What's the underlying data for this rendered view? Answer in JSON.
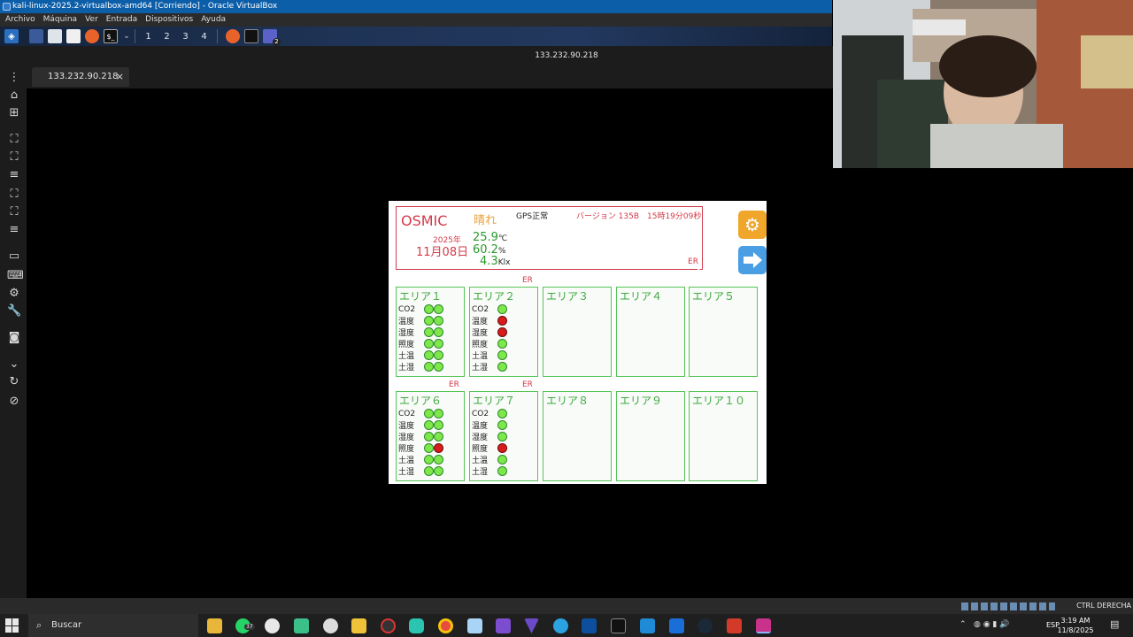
{
  "vbox": {
    "title": "kali-linux-2025.2-virtualbox-amd64 [Corriendo] - Oracle VirtualBox",
    "menu": [
      "Archivo",
      "Máquina",
      "Ver",
      "Entrada",
      "Dispositivos",
      "Ayuda"
    ]
  },
  "kali_panel": {
    "workspaces": [
      "1",
      "2",
      "3",
      "4"
    ],
    "badge": "2"
  },
  "remote": {
    "host_title": "133.232.90.218",
    "tab_label": "133.232.90.218",
    "tab_close": "×",
    "status_right": "CTRL DERECHA"
  },
  "osmic": {
    "brand": "OSMIC",
    "weather": "晴れ",
    "gps_status": "GPS正常",
    "version": "バージョン 135B",
    "time": "15時19分09秒",
    "year": "2025年",
    "date": "11月08日",
    "temperature": "25.9",
    "temperature_unit": "℃",
    "humidity": "60.2",
    "humidity_unit": "%",
    "illuminance": "4.3",
    "illuminance_unit": "Klx",
    "header_er": "ER",
    "areas": [
      {
        "name": "エリア１",
        "er": "",
        "sensors": [
          [
            "CO2",
            "g",
            "g"
          ],
          [
            "温度",
            "g",
            "g"
          ],
          [
            "湿度",
            "g",
            "g"
          ],
          [
            "照度",
            "g",
            "g"
          ],
          [
            "土温",
            "g",
            "g"
          ],
          [
            "土湿",
            "g",
            "g"
          ]
        ]
      },
      {
        "name": "エリア２",
        "er": "ER",
        "sensors": [
          [
            "CO2",
            "g"
          ],
          [
            "温度",
            "r"
          ],
          [
            "湿度",
            "r"
          ],
          [
            "照度",
            "g"
          ],
          [
            "土温",
            "g"
          ],
          [
            "土湿",
            "g"
          ]
        ]
      },
      {
        "name": "エリア３",
        "er": "",
        "sensors": []
      },
      {
        "name": "エリア４",
        "er": "",
        "sensors": []
      },
      {
        "name": "エリア５",
        "er": "",
        "sensors": []
      },
      {
        "name": "エリア６",
        "er": "ER",
        "sensors": [
          [
            "CO2",
            "g",
            "g"
          ],
          [
            "温度",
            "g",
            "g"
          ],
          [
            "湿度",
            "g",
            "g"
          ],
          [
            "照度",
            "g",
            "r"
          ],
          [
            "土温",
            "g",
            "g"
          ],
          [
            "土湿",
            "g",
            "g"
          ]
        ]
      },
      {
        "name": "エリア７",
        "er": "ER",
        "sensors": [
          [
            "CO2",
            "g"
          ],
          [
            "温度",
            "g"
          ],
          [
            "湿度",
            "g"
          ],
          [
            "照度",
            "r"
          ],
          [
            "土温",
            "g"
          ],
          [
            "土湿",
            "g"
          ]
        ]
      },
      {
        "name": "エリア８",
        "er": "",
        "sensors": []
      },
      {
        "name": "エリア９",
        "er": "",
        "sensors": []
      },
      {
        "name": "エリア１０",
        "er": "",
        "sensors": []
      }
    ]
  },
  "taskbar": {
    "search_placeholder": "Buscar",
    "whatsapp_badge": "37",
    "language": "ESP",
    "time": "3:19 AM",
    "date": "11/8/2025"
  },
  "colors": {
    "ok": "#7ee84a",
    "alert": "#d81c1c",
    "osmic_red": "#d33a4a",
    "area_green": "#55c455",
    "vbox_blue": "#0c5ea8"
  }
}
